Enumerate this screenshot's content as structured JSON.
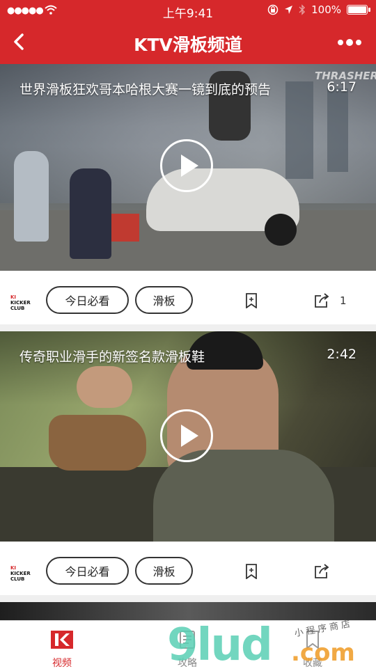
{
  "status_bar": {
    "signal": "●●●●●",
    "time": "上午9:41",
    "battery": "100%"
  },
  "nav": {
    "title": "KTV滑板频道"
  },
  "feed": [
    {
      "title": "世界滑板狂欢哥本哈根大赛一镜到底的预告",
      "duration": "6:17",
      "tags": [
        "今日必看",
        "滑板"
      ],
      "share_count": "1",
      "overlay_text": "THRASHER",
      "source_logo": "KICKER CLUB"
    },
    {
      "title": "传奇职业滑手的新签名款滑板鞋",
      "duration": "2:42",
      "tags": [
        "今日必看",
        "滑板"
      ],
      "share_count": "",
      "source_logo": "KICKER CLUB"
    }
  ],
  "tabs": [
    {
      "label": "视频",
      "active": true
    },
    {
      "label": "攻略",
      "active": false
    },
    {
      "label": "收藏",
      "active": false
    }
  ],
  "watermark": {
    "main": "9lud",
    "suffix": ".com",
    "tagline": "小程序商店"
  },
  "colors": {
    "brand_red": "#d6282b",
    "inactive_gray": "#888888"
  }
}
